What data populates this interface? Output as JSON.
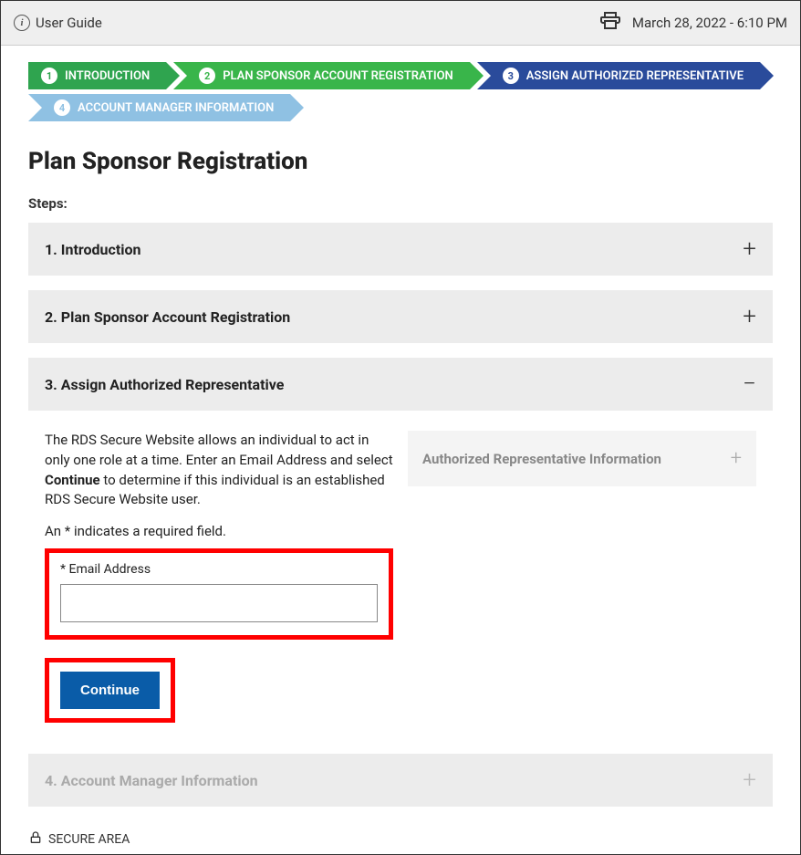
{
  "header": {
    "title": "User Guide",
    "timestamp": "March 28, 2022 - 6:10 PM"
  },
  "breadcrumb": [
    {
      "num": "1",
      "label": "INTRODUCTION"
    },
    {
      "num": "2",
      "label": "PLAN SPONSOR ACCOUNT REGISTRATION"
    },
    {
      "num": "3",
      "label": "ASSIGN AUTHORIZED REPRESENTATIVE"
    },
    {
      "num": "4",
      "label": "ACCOUNT MANAGER INFORMATION"
    }
  ],
  "page_title": "Plan Sponsor Registration",
  "steps_label": "Steps:",
  "accordions": [
    {
      "title": "1. Introduction",
      "icon": "+"
    },
    {
      "title": "2. Plan Sponsor Account Registration",
      "icon": "+"
    },
    {
      "title": "3. Assign Authorized Representative",
      "icon": "−"
    },
    {
      "title": "4. Account Manager Information",
      "icon": "+"
    }
  ],
  "body": {
    "para_pre": "The RDS Secure Website allows an individual to act in only one role at a time. Enter an Email Address and select ",
    "para_bold": "Continue",
    "para_post": " to determine if this individual is an established RDS Secure Website user.",
    "required_note": "An * indicates a required field.",
    "email_label": "* Email Address",
    "continue_label": "Continue",
    "info_panel_title": "Authorized Representative Information"
  },
  "footer": {
    "secure_label": "SECURE AREA"
  }
}
